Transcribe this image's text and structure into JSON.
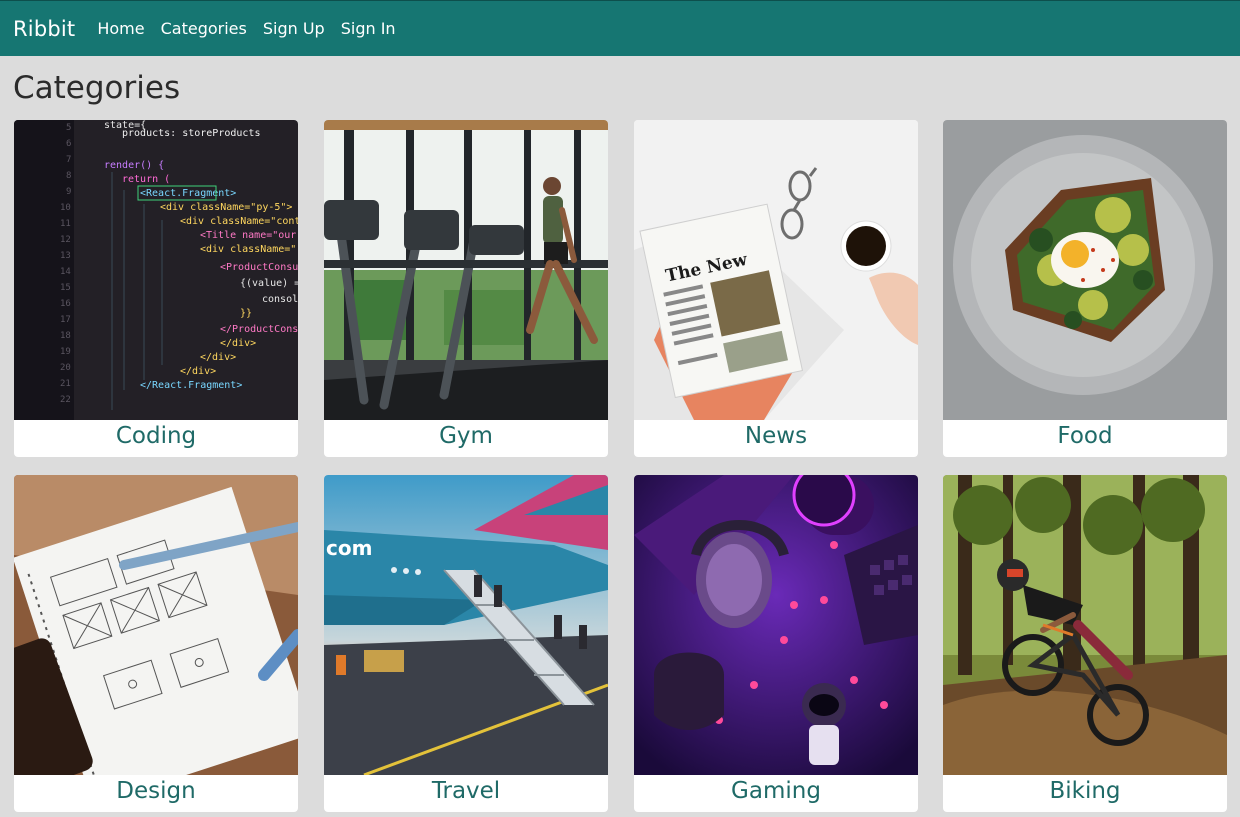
{
  "navbar": {
    "brand": "Ribbit",
    "links": [
      "Home",
      "Categories",
      "Sign Up",
      "Sign In"
    ]
  },
  "page": {
    "title": "Categories"
  },
  "categories": [
    {
      "label": "Coding"
    },
    {
      "label": "Gym"
    },
    {
      "label": "News"
    },
    {
      "label": "Food"
    },
    {
      "label": "Design"
    },
    {
      "label": "Travel"
    },
    {
      "label": "Gaming"
    },
    {
      "label": "Biking"
    }
  ],
  "code_snippet": [
    "state={",
    "products: storeProducts",
    "render() {",
    "return (",
    "<React.Fragment>",
    "<div className=\"py-5\">",
    "<div className=\"contain",
    "<Title name=\"our\" t",
    "<div className=\"row",
    "<ProductConsume",
    "{(value) =>",
    "consol",
    "}}",
    "</ProductConsum",
    "</div>",
    "</div>",
    "</div>",
    "</React.Fragment>"
  ],
  "newspaper_masthead": "The New",
  "plane_text": "com",
  "colors": {
    "navbar": "#167672",
    "background": "#dcdcdc",
    "caption": "#1f6a67"
  }
}
